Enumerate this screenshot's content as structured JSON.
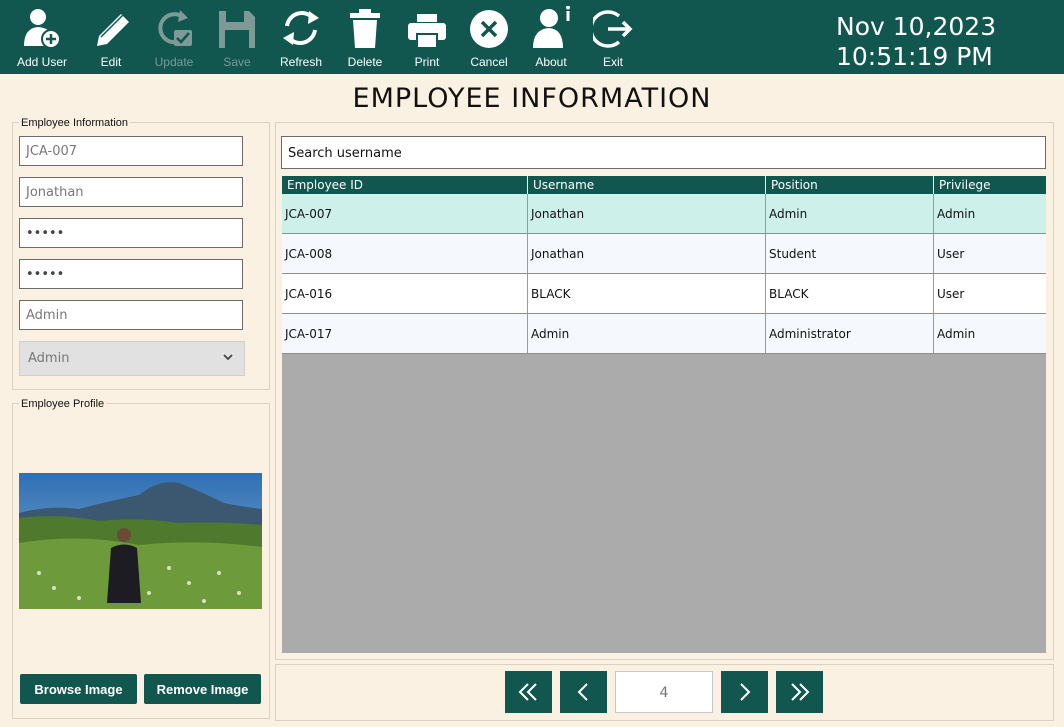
{
  "toolbar": {
    "buttons": [
      {
        "label": "Add User",
        "icon": "add-user-icon"
      },
      {
        "label": "Edit",
        "icon": "pencil-icon"
      },
      {
        "label": "Update",
        "icon": "update-icon"
      },
      {
        "label": "Save",
        "icon": "save-icon"
      },
      {
        "label": "Refresh",
        "icon": "refresh-icon"
      },
      {
        "label": "Delete",
        "icon": "trash-icon"
      },
      {
        "label": "Print",
        "icon": "printer-icon"
      },
      {
        "label": "Cancel",
        "icon": "cancel-icon"
      },
      {
        "label": "About",
        "icon": "about-icon"
      },
      {
        "label": "Exit",
        "icon": "exit-icon"
      }
    ]
  },
  "clock": {
    "date": "Nov 10,2023",
    "time": "10:51:19 PM"
  },
  "page_title": "EMPLOYEE INFORMATION",
  "employee_info": {
    "group_label": "Employee Information",
    "employee_id": "JCA-007",
    "username": "Jonathan",
    "password": "•••••",
    "confirm_password": "•••••",
    "position": "Admin",
    "privilege": "Admin"
  },
  "employee_profile": {
    "group_label": "Employee Profile",
    "browse_label": "Browse Image",
    "remove_label": "Remove Image"
  },
  "search": {
    "placeholder": "Search username"
  },
  "table": {
    "columns": [
      "Employee ID",
      "Username",
      "Position",
      "Privilege"
    ],
    "rows": [
      [
        "JCA-007",
        "Jonathan",
        "Admin",
        "Admin"
      ],
      [
        "JCA-008",
        "Jonathan",
        "Student",
        "User"
      ],
      [
        "JCA-016",
        "BLACK",
        "BLACK",
        "User"
      ],
      [
        "JCA-017",
        "Admin",
        "Administrator",
        "Admin"
      ]
    ],
    "selected_row": 0
  },
  "pagination": {
    "page": "4"
  },
  "colors": {
    "primary": "#11574f",
    "background": "#faf1e2",
    "selected_row": "#cdf1ea",
    "alt_row": "#f5f9fd",
    "grid_empty": "#ababab"
  }
}
